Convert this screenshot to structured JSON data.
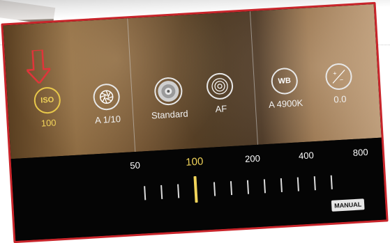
{
  "settings": {
    "iso": {
      "icon_text": "ISO",
      "value": "100"
    },
    "shutter": {
      "label": "A 1/10",
      "icon": "aperture-icon"
    },
    "metering": {
      "label": "Standard",
      "icon": "metering-icon"
    },
    "focus": {
      "label": "AF",
      "icon": "focus-icon"
    },
    "wb": {
      "icon_text": "WB",
      "label": "A 4900K"
    },
    "exposure": {
      "label": "0.0",
      "icon_plus": "+",
      "icon_minus": "−"
    }
  },
  "dial": {
    "scale": [
      "50",
      "100",
      "200",
      "400",
      "800"
    ],
    "selected": "100",
    "mode_label": "MANUAL"
  },
  "colors": {
    "accent": "#f1d45a",
    "annotation": "#e0353a"
  }
}
